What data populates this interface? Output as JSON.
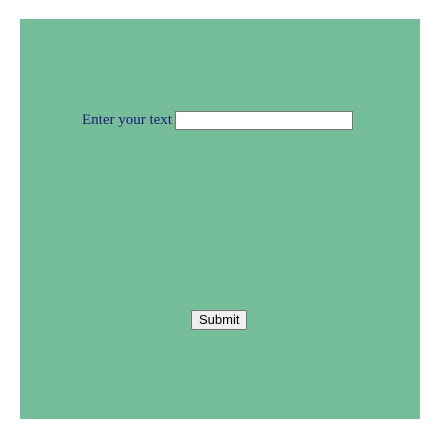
{
  "form": {
    "label": "Enter your text",
    "input_value": "",
    "input_placeholder": "",
    "submit_label": "Submit"
  },
  "colors": {
    "background": "#ffffff",
    "panel": "#75bd98",
    "label_text": "#1e1b78"
  }
}
